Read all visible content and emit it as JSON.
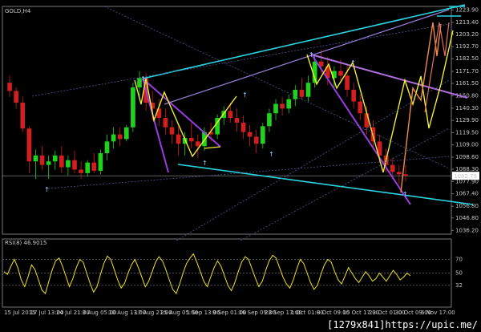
{
  "chart_data": [
    {
      "type": "candlestick",
      "title": "GOLD,H4",
      "y_ticks": [
        "1223.90",
        "1213.40",
        "1203.20",
        "1192.70",
        "1182.50",
        "1171.70",
        "1161.50",
        "1150.80",
        "1140.30",
        "1129.90",
        "1119.50",
        "1109.00",
        "1098.60",
        "1088.30",
        "1077.90",
        "1067.40",
        "1056.80",
        "1046.80",
        "1036.20"
      ],
      "current_price": "1082.75",
      "x_ticks": [
        "15 Jul 2015",
        "17 Jul 13:00",
        "24 Jul 21:00",
        "3 Aug 05:00",
        "10 Aug 13:00",
        "17 Aug 21:00",
        "25 Aug 05:00",
        "1 Sep 13:00",
        "9 Sep 01:00",
        "16 Sep 09:00",
        "23 Sep 17:00",
        "1 Oct 01:00",
        "8 Oct 09:00",
        "15 Oct 17:00",
        "23 Oct 01:00",
        "30 Oct 09:00",
        "6 Nov 17:00"
      ],
      "ylim": [
        1033,
        1227
      ],
      "series": [
        {
          "values": [
            [
              1162,
              1168,
              1150,
              1155
            ],
            [
              1155,
              1158,
              1140,
              1145
            ],
            [
              1145,
              1150,
              1120,
              1123
            ],
            [
              1123,
              1125,
              1085,
              1095
            ],
            [
              1095,
              1105,
              1080,
              1100
            ],
            [
              1100,
              1108,
              1088,
              1092
            ],
            [
              1092,
              1100,
              1080,
              1095
            ],
            [
              1095,
              1104,
              1088,
              1100
            ],
            [
              1100,
              1108,
              1085,
              1090
            ],
            [
              1090,
              1100,
              1083,
              1096
            ],
            [
              1096,
              1104,
              1085,
              1088
            ],
            [
              1088,
              1095,
              1080,
              1085
            ],
            [
              1085,
              1096,
              1082,
              1094
            ],
            [
              1094,
              1102,
              1085,
              1087
            ],
            [
              1087,
              1105,
              1084,
              1102
            ],
            [
              1102,
              1118,
              1096,
              1112
            ],
            [
              1112,
              1124,
              1106,
              1118
            ],
            [
              1118,
              1124,
              1108,
              1114
            ],
            [
              1114,
              1126,
              1112,
              1124
            ],
            [
              1124,
              1162,
              1120,
              1158
            ],
            [
              1158,
              1172,
              1150,
              1166
            ],
            [
              1166,
              1170,
              1138,
              1145
            ],
            [
              1145,
              1155,
              1130,
              1140
            ],
            [
              1140,
              1148,
              1125,
              1132
            ],
            [
              1132,
              1140,
              1118,
              1124
            ],
            [
              1124,
              1130,
              1110,
              1118
            ],
            [
              1118,
              1125,
              1100,
              1110
            ],
            [
              1110,
              1120,
              1100,
              1115
            ],
            [
              1115,
              1128,
              1106,
              1112
            ],
            [
              1112,
              1118,
              1098,
              1108
            ],
            [
              1108,
              1124,
              1104,
              1120
            ],
            [
              1120,
              1128,
              1112,
              1118
            ],
            [
              1118,
              1135,
              1114,
              1132
            ],
            [
              1132,
              1142,
              1126,
              1138
            ],
            [
              1138,
              1145,
              1128,
              1132
            ],
            [
              1132,
              1140,
              1120,
              1128
            ],
            [
              1128,
              1134,
              1114,
              1120
            ],
            [
              1120,
              1126,
              1108,
              1116
            ],
            [
              1116,
              1122,
              1102,
              1110
            ],
            [
              1110,
              1128,
              1106,
              1125
            ],
            [
              1125,
              1140,
              1120,
              1136
            ],
            [
              1136,
              1148,
              1130,
              1144
            ],
            [
              1144,
              1150,
              1134,
              1140
            ],
            [
              1140,
              1152,
              1136,
              1148
            ],
            [
              1148,
              1160,
              1142,
              1156
            ],
            [
              1156,
              1166,
              1148,
              1150
            ],
            [
              1150,
              1168,
              1146,
              1162
            ],
            [
              1162,
              1185,
              1158,
              1180
            ],
            [
              1180,
              1190,
              1170,
              1176
            ],
            [
              1176,
              1184,
              1160,
              1166
            ],
            [
              1166,
              1176,
              1158,
              1172
            ],
            [
              1172,
              1182,
              1164,
              1168
            ],
            [
              1168,
              1178,
              1150,
              1156
            ],
            [
              1156,
              1162,
              1140,
              1146
            ],
            [
              1146,
              1152,
              1130,
              1136
            ],
            [
              1136,
              1142,
              1118,
              1124
            ],
            [
              1124,
              1130,
              1105,
              1112
            ],
            [
              1112,
              1118,
              1094,
              1100
            ],
            [
              1100,
              1106,
              1086,
              1092
            ],
            [
              1092,
              1098,
              1080,
              1086
            ],
            [
              1086,
              1092,
              1076,
              1084
            ],
            [
              1084,
              1092,
              1078,
              1083
            ]
          ]
        }
      ]
    },
    {
      "type": "line",
      "title": "RSI(8) 46.9015",
      "y_ticks": [
        "70",
        "50",
        "32"
      ],
      "ylim": [
        0,
        100
      ],
      "series": [
        {
          "values": [
            52,
            48,
            60,
            70,
            58,
            40,
            30,
            45,
            62,
            55,
            40,
            25,
            20,
            38,
            55,
            68,
            72,
            60,
            45,
            30,
            42,
            58,
            70,
            66,
            50,
            35,
            22,
            30,
            48,
            64,
            75,
            70,
            55,
            40,
            28,
            35,
            50,
            62,
            70,
            58,
            44,
            30,
            38,
            52,
            66,
            74,
            68,
            55,
            40,
            26,
            20,
            34,
            50,
            64,
            72,
            78,
            66,
            52,
            38,
            30,
            44,
            58,
            68,
            60,
            46,
            32,
            24,
            36,
            52,
            66,
            74,
            70,
            56,
            42,
            30,
            38,
            54,
            68,
            76,
            72,
            58,
            44,
            34,
            28,
            40,
            56,
            70,
            64,
            50,
            36,
            26,
            32,
            48,
            62,
            70,
            66,
            52,
            40,
            34,
            46,
            58,
            50,
            42,
            36,
            44,
            52,
            46,
            38,
            42,
            50,
            44,
            38,
            46,
            54,
            48,
            40,
            44,
            50,
            46
          ]
        }
      ]
    }
  ]
}
